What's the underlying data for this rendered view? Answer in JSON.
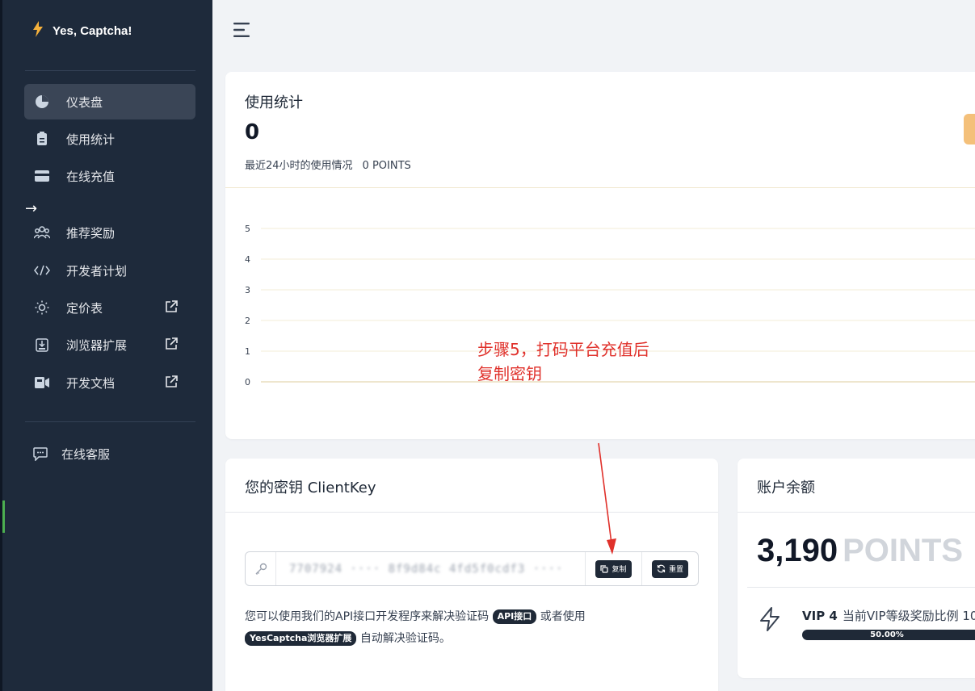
{
  "app": {
    "name": "Yes, Captcha!"
  },
  "sidebar": {
    "items": [
      {
        "label": "仪表盘",
        "icon": "pie-chart-icon",
        "active": true,
        "external": false
      },
      {
        "label": "使用统计",
        "icon": "clipboard-icon",
        "active": false,
        "external": false
      },
      {
        "label": "在线充值",
        "icon": "credit-card-icon",
        "active": false,
        "external": false
      },
      {
        "label": "推荐奖励",
        "icon": "users-icon",
        "active": false,
        "external": false
      },
      {
        "label": "开发者计划",
        "icon": "code-icon",
        "active": false,
        "external": false
      },
      {
        "label": "定价表",
        "icon": "sun-icon",
        "active": false,
        "external": true
      },
      {
        "label": "浏览器扩展",
        "icon": "download-icon",
        "active": false,
        "external": true
      },
      {
        "label": "开发文档",
        "icon": "document-icon",
        "active": false,
        "external": true
      }
    ],
    "support": {
      "label": "在线客服",
      "icon": "chat-icon"
    }
  },
  "stats": {
    "title": "使用统计",
    "value": "0",
    "subtitle": "最近24小时的使用情况",
    "points": "0 POINTS"
  },
  "chart_data": {
    "type": "line",
    "y_ticks": [
      "5",
      "4",
      "3",
      "2",
      "1",
      "0"
    ],
    "ylim": [
      0,
      5
    ],
    "x": [],
    "series": [
      {
        "values": []
      }
    ],
    "grid": true,
    "colors": {
      "grid": "#f3ecd7",
      "axis": "#e8ddbd"
    }
  },
  "annotation": {
    "line1": "步骤5，打码平台充值后",
    "line2": "复制密钥",
    "color": "#e0312b"
  },
  "client_key": {
    "title": "您的密钥 ClientKey",
    "value": "7707924 ···· 8f9d84c 4fd5f0cdf3 ···· c6",
    "copy_label": "复制",
    "reset_label": "重置",
    "desc_part1": "您可以使用我们的API接口开发程序来解决验证码",
    "api_badge": "API接口",
    "desc_part2": "或者使用",
    "ext_badge": "YesCaptcha浏览器扩展",
    "desc_part3": "自动解决验证码。"
  },
  "balance": {
    "title": "账户余额",
    "amount": "3,190",
    "unit": "POINTS",
    "vip_level": "VIP 4",
    "vip_desc": "当前VIP等级奖励比例 10",
    "progress_text": "50.00%",
    "progress": 0.5
  }
}
